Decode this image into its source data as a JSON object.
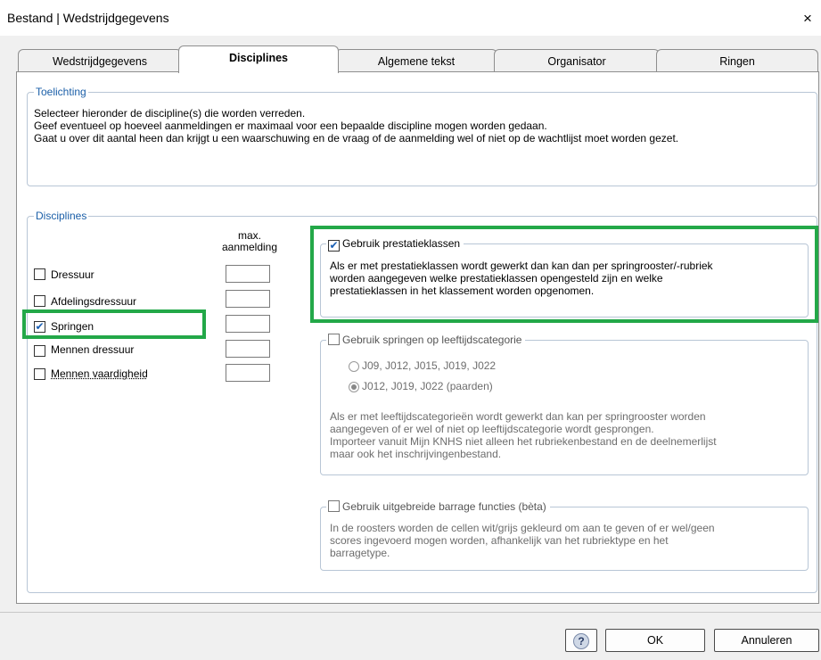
{
  "window": {
    "title": "Bestand | Wedstrijdgegevens",
    "close_symbol": "×"
  },
  "tabs": [
    {
      "label": "Wedstrijdgegevens"
    },
    {
      "label": "Disciplines"
    },
    {
      "label": "Algemene tekst"
    },
    {
      "label": "Organisator"
    },
    {
      "label": "Ringen"
    }
  ],
  "toelichting": {
    "legend": "Toelichting",
    "lines": [
      "Selecteer hieronder de discipline(s) die worden verreden.",
      "Geef eventueel op hoeveel aanmeldingen er maximaal voor een bepaalde discipline mogen worden gedaan.",
      "Gaat u over dit aantal heen dan krijgt u een waarschuwing en de vraag of de aanmelding wel of niet op de wachtlijst moet worden gezet."
    ]
  },
  "disciplines": {
    "legend": "Disciplines",
    "max_header_line1": "max.",
    "max_header_line2": "aanmelding",
    "items": [
      {
        "label": "Dressuur",
        "checked": false
      },
      {
        "label": "Afdelingsdressuur",
        "checked": false
      },
      {
        "label": "Springen",
        "checked": true
      },
      {
        "label": "Mennen dressuur",
        "checked": false
      },
      {
        "label": "Mennen vaardigheid",
        "checked": false
      }
    ]
  },
  "prestatie": {
    "label": "Gebruik prestatieklassen",
    "checked": true,
    "desc1": "Als er met prestatieklassen wordt gewerkt dan kan dan per springrooster/-rubriek",
    "desc2": "worden aangegeven welke prestatieklassen opengesteld zijn en welke",
    "desc3": "prestatieklassen in het klassement worden opgenomen."
  },
  "leeftijd": {
    "label": "Gebruik springen op leeftijdscategorie",
    "checked": false,
    "radio1": "J09, J012, J015, J019, J022",
    "radio2": "J012, J019, J022 (paarden)",
    "desc1": "Als er met leeftijdscategorieën wordt gewerkt dan kan per springrooster worden",
    "desc2": "aangegeven of er wel of niet op leeftijdscategorie wordt gesprongen.",
    "desc3": "Importeer vanuit Mijn KNHS niet alleen het rubriekenbestand en de deelnemerlijst",
    "desc4": "maar ook het inschrijvingenbestand."
  },
  "barrage": {
    "label": "Gebruik uitgebreide barrage functies (bèta)",
    "checked": false,
    "desc1": "In de roosters worden de cellen wit/grijs gekleurd om aan te geven of er wel/geen",
    "desc2": "scores ingevoerd mogen worden, afhankelijk van het rubriektype en het",
    "desc3": "barragetype."
  },
  "buttons": {
    "help": "?",
    "ok": "OK",
    "cancel": "Annuleren"
  },
  "colors": {
    "highlight": "#23a848",
    "legend_blue": "#1b5fa8",
    "check_blue": "#1a5fb4"
  }
}
